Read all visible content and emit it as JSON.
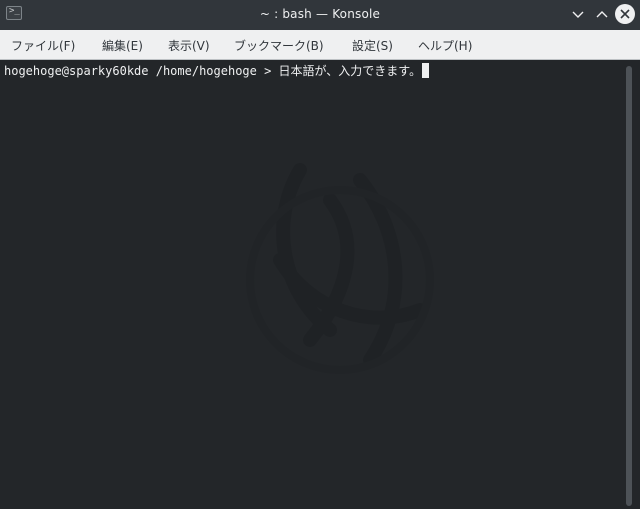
{
  "window": {
    "title": "~ : bash — Konsole",
    "app_icon_glyph": ">_",
    "buttons": {
      "minimize": "chevron-down-icon",
      "maximize": "chevron-up-icon",
      "close": "close-icon"
    }
  },
  "menu": {
    "items": [
      {
        "label": "ファイル(F)"
      },
      {
        "label": "編集(E)"
      },
      {
        "label": "表示(V)"
      },
      {
        "label": "ブックマーク(B)"
      },
      {
        "label": "設定(S)"
      },
      {
        "label": "ヘルプ(H)"
      }
    ]
  },
  "terminal": {
    "prompt": "hogehoge@sparky60kde /home/hogehoge > ",
    "input": "日本語が、入力できます。",
    "colors": {
      "background": "#232629",
      "foreground": "#eff0f1"
    }
  }
}
